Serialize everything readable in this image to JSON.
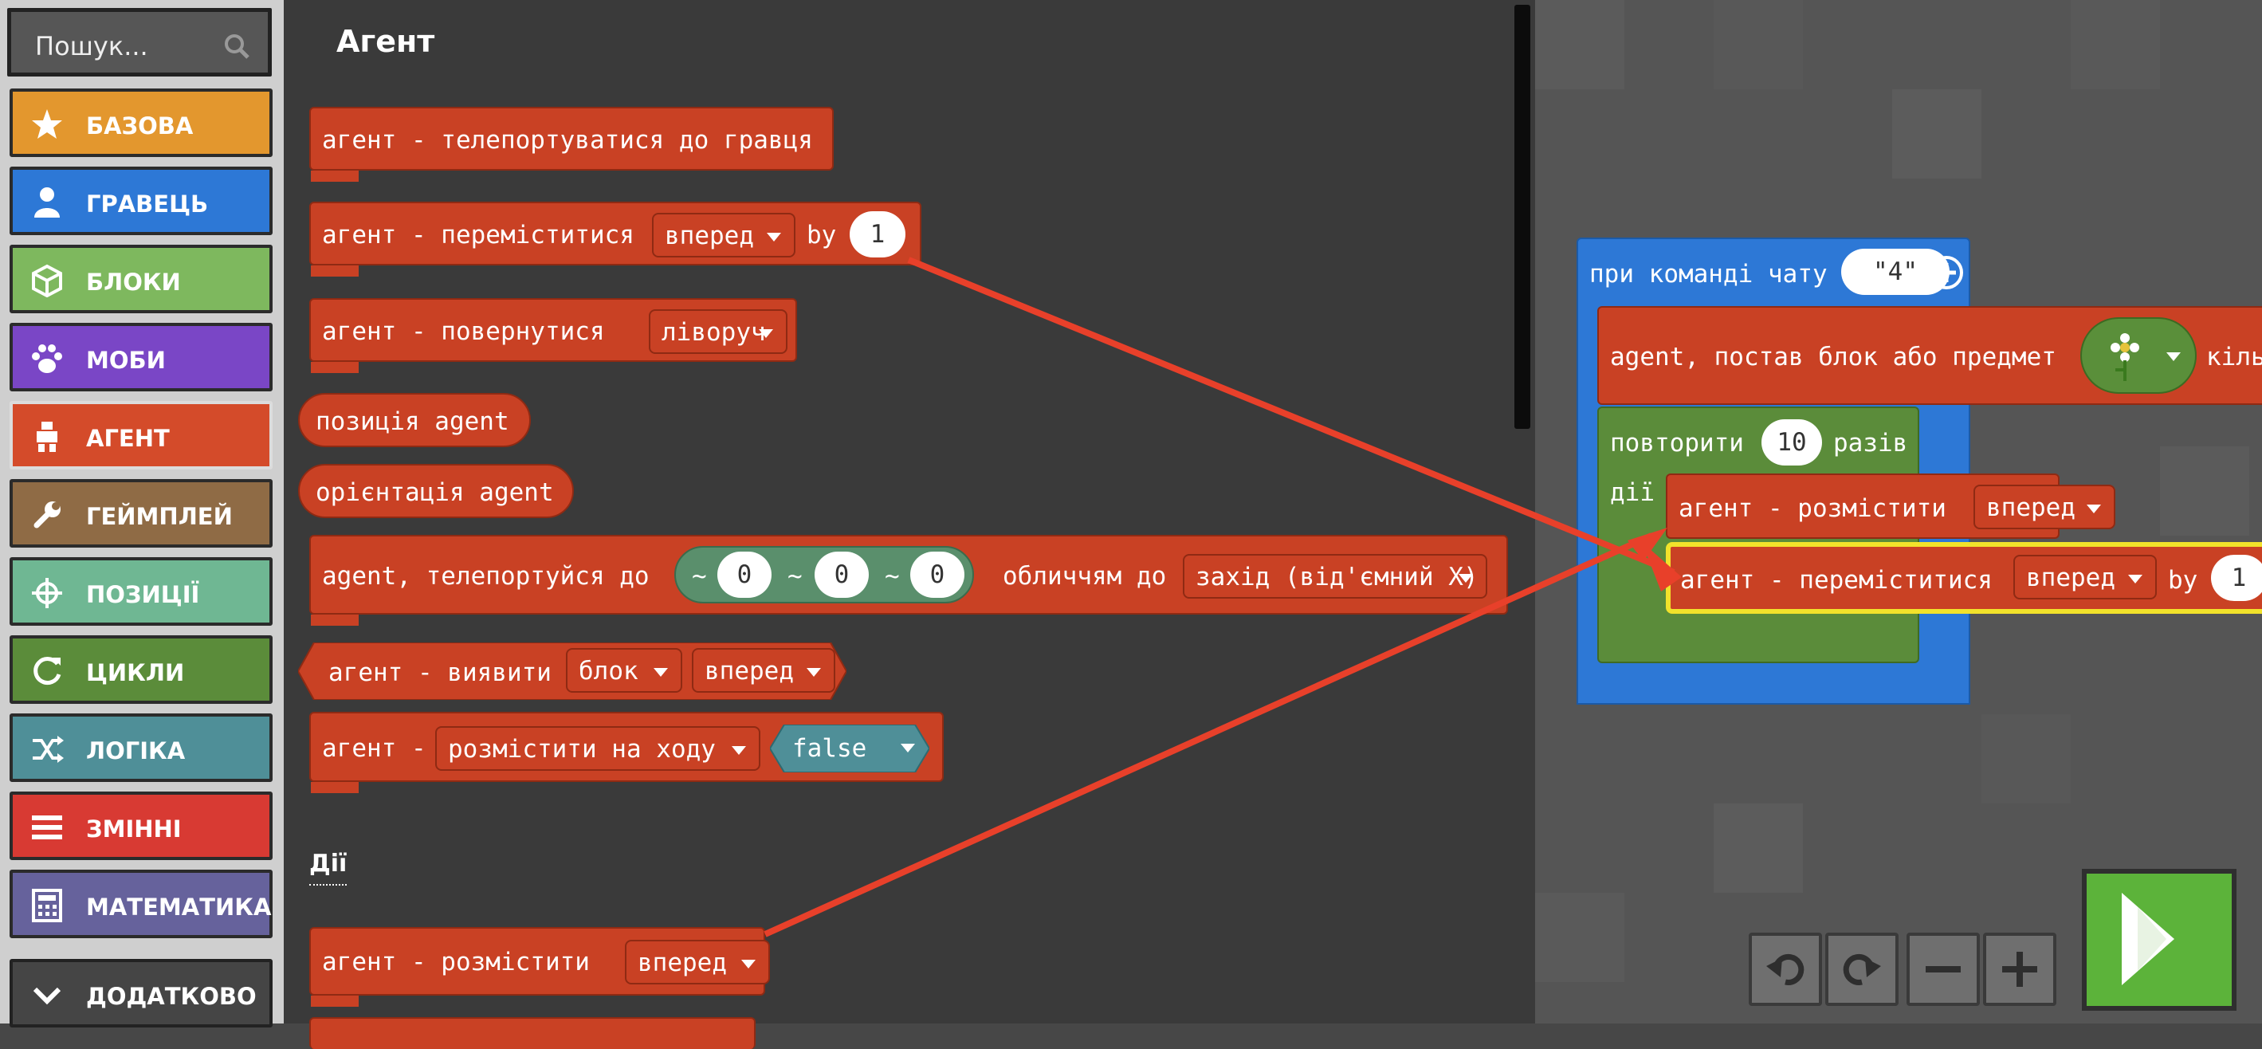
{
  "search": {
    "placeholder": "Пошук...",
    "icon": "search-icon"
  },
  "categories": [
    {
      "label": "БАЗОВА",
      "color": "#e3972e",
      "icon": "star-icon"
    },
    {
      "label": "ГРАВЕЦЬ",
      "color": "#2d78d6",
      "icon": "person-icon"
    },
    {
      "label": "БЛОКИ",
      "color": "#7eb85e",
      "icon": "cube-icon"
    },
    {
      "label": "МОБИ",
      "color": "#7a46c6",
      "icon": "paw-icon"
    },
    {
      "label": "АГЕНТ",
      "color": "#d44b2a",
      "icon": "agent-icon"
    },
    {
      "label": "ГЕЙМПЛЕЙ",
      "color": "#8f6b45",
      "icon": "wrench-icon"
    },
    {
      "label": "ПОЗИЦІЇ",
      "color": "#6fb793",
      "icon": "crosshair-icon"
    },
    {
      "label": "ЦИКЛИ",
      "color": "#5b8c3a",
      "icon": "loop-icon"
    },
    {
      "label": "ЛОГІКА",
      "color": "#4f8f98",
      "icon": "shuffle-icon"
    },
    {
      "label": "ЗМІННІ",
      "color": "#d83a33",
      "icon": "list-icon"
    },
    {
      "label": "МАТЕМАТИКА",
      "color": "#66629c",
      "icon": "calculator-icon"
    }
  ],
  "more": {
    "label": "ДОДАТКОВО",
    "icon": "chevron-down-icon"
  },
  "flyout": {
    "title": "Агент",
    "section_actions": "Дії",
    "teleport_to_player": "агент - телепортуватися до гравця",
    "move": {
      "prefix": "агент - переміститися",
      "direction": "вперед",
      "by": "by",
      "amount": "1"
    },
    "turn": {
      "prefix": "агент - повернутися",
      "direction": "ліворуч"
    },
    "position": "позиція agent",
    "orientation": "орієнтація agent",
    "teleport": {
      "prefix": "agent, телепортуйся до",
      "tilde": "~",
      "x": "0",
      "y": "0",
      "z": "0",
      "facing": "обличчям до",
      "direction": "захід (від'ємний X)"
    },
    "detect": {
      "prefix": "агент - виявити",
      "kind": "блок",
      "direction": "вперед"
    },
    "set": {
      "prefix": "агент -",
      "option": "розмістити на ходу",
      "value": "false"
    },
    "place": {
      "prefix": "агент - розмістити",
      "direction": "вперед"
    }
  },
  "workspace": {
    "event": {
      "label": "при команді чату",
      "command": "\"4\""
    },
    "place_item": {
      "label": "agent, постав блок або предмет",
      "suffix": "кіль"
    },
    "repeat": {
      "label": "повторити",
      "times": "10",
      "suffix": "разів",
      "do": "дії"
    },
    "place": {
      "prefix": "агент - розмістити",
      "direction": "вперед"
    },
    "move": {
      "prefix": "агент - переміститися",
      "direction": "вперед",
      "by": "by",
      "amount": "1"
    }
  },
  "controls": [
    "undo-icon",
    "redo-icon",
    "zoom-out-icon",
    "zoom-in-icon",
    "play-icon"
  ]
}
